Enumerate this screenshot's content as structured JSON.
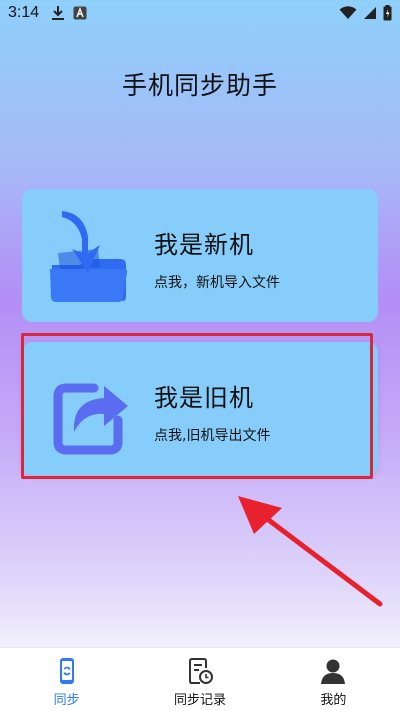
{
  "status_bar": {
    "time": "3:14",
    "left_icons": [
      "download-icon",
      "keyboard-icon"
    ],
    "right_icons": [
      "wifi-icon",
      "signal-icon",
      "battery-icon"
    ]
  },
  "app": {
    "title": "手机同步助手"
  },
  "cards": {
    "new_phone": {
      "title": "我是新机",
      "subtitle": "点我，新机导入文件",
      "icon": "folder-import-icon"
    },
    "old_phone": {
      "title": "我是旧机",
      "subtitle": "点我,旧机导出文件",
      "icon": "share-export-icon"
    }
  },
  "annotation": {
    "highlight_color": "#d42a3a",
    "arrow_color": "#e8212e"
  },
  "bottom_nav": {
    "items": [
      {
        "label": "同步",
        "icon": "phone-sync-icon",
        "active": true
      },
      {
        "label": "同步记录",
        "icon": "history-icon",
        "active": false
      },
      {
        "label": "我的",
        "icon": "user-icon",
        "active": false
      }
    ]
  },
  "colors": {
    "accent": "#2f7bef",
    "card_bg": "#86cdfb",
    "folder_blue": "#2f6bf2",
    "export_icon": "#5a6cf0"
  }
}
